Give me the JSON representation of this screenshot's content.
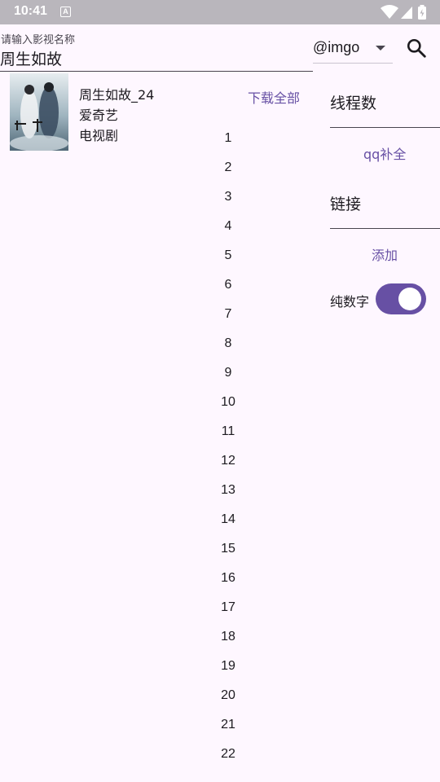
{
  "status_bar": {
    "time": "10:41",
    "notification_icon": "A"
  },
  "search": {
    "label": "请输入影视名称",
    "value": "周生如故",
    "source": "@imgo"
  },
  "result": {
    "title": "周生如故_24",
    "platform": "爱奇艺",
    "category": "电视剧",
    "download_all": "下载全部",
    "poster_icon": "poster-image"
  },
  "episodes": [
    "1",
    "2",
    "3",
    "4",
    "5",
    "6",
    "7",
    "8",
    "9",
    "10",
    "11",
    "12",
    "13",
    "14",
    "15",
    "16",
    "17",
    "18",
    "19",
    "20",
    "21",
    "22"
  ],
  "panel": {
    "threads_label": "线程数",
    "qq_complete": "qq补全",
    "link_label": "链接",
    "add_button": "添加",
    "numeric_only_label": "纯数字",
    "numeric_only_on": true
  },
  "colors": {
    "primary": "#6750A4",
    "background": "#FEF7FF",
    "status_bar": "#B9B6BC"
  }
}
